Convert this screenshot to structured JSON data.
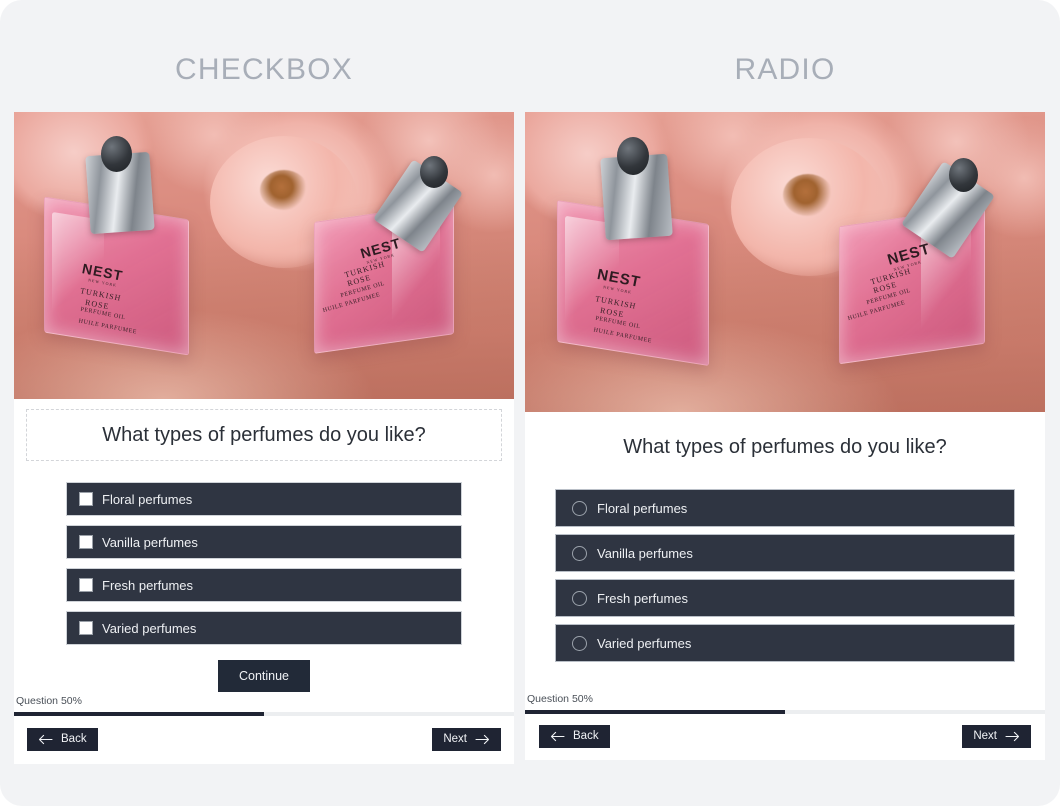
{
  "page": {
    "background_color": "#f2f3f5",
    "card_background": "#ffffff",
    "accent_dark": "#2f3542",
    "accent_navy": "#1f2433",
    "heading_color": "#a8aeb8"
  },
  "columns": [
    {
      "heading": "CHECKBOX",
      "input_type": "checkbox",
      "question": "What types of perfumes do you like?",
      "options": [
        {
          "label": "Floral perfumes",
          "checked": false
        },
        {
          "label": "Vanilla perfumes",
          "checked": false
        },
        {
          "label": "Fresh perfumes",
          "checked": false
        },
        {
          "label": "Varied perfumes",
          "checked": false
        }
      ],
      "continue_label": "Continue",
      "progress_label": "Question 50%",
      "progress_percent": 50,
      "back_label": "Back",
      "next_label": "Next"
    },
    {
      "heading": "RADIO",
      "input_type": "radio",
      "question": "What types of perfumes do you like?",
      "options": [
        {
          "label": "Floral perfumes",
          "checked": false
        },
        {
          "label": "Vanilla perfumes",
          "checked": false
        },
        {
          "label": "Fresh perfumes",
          "checked": false
        },
        {
          "label": "Varied perfumes",
          "checked": false
        }
      ],
      "progress_label": "Question 50%",
      "progress_percent": 50,
      "back_label": "Back",
      "next_label": "Next"
    }
  ],
  "hero_image": {
    "description": "Two pink glass perfume bottles with silver dropper caps resting on a peach surface surrounded by pink roses",
    "brand": "NEST",
    "brand_sub": "NEW YORK",
    "product_line_1": "TURKISH",
    "product_line_2": "ROSE",
    "product_line_3": "PERFUME OIL",
    "product_line_4": "HUILE PARFUMEE"
  }
}
